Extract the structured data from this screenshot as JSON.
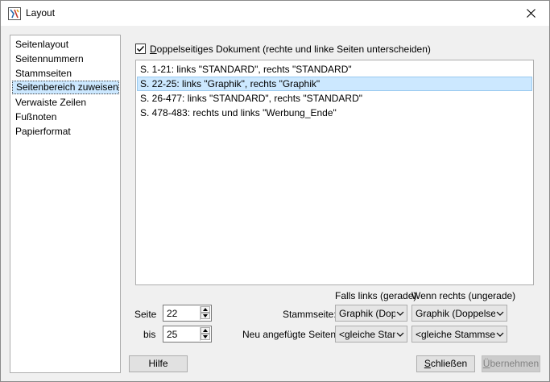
{
  "window": {
    "title": "Layout"
  },
  "nav": {
    "items": [
      {
        "label": "Seitenlayout"
      },
      {
        "label": "Seitennummern"
      },
      {
        "label": "Stammseiten"
      },
      {
        "label": "Seitenbereich zuweisen",
        "selected": true
      },
      {
        "label": "Verwaiste Zeilen"
      },
      {
        "label": "Fußnoten"
      },
      {
        "label": "Papierformat"
      }
    ]
  },
  "duplex": {
    "checked": true,
    "label_accel": "D",
    "label_rest": "oppelseitiges Dokument (rechte und linke Seiten unterscheiden)"
  },
  "ranges": [
    {
      "text": "S. 1-21: links \"STANDARD\", rechts \"STANDARD\""
    },
    {
      "text": "S. 22-25: links \"Graphik\", rechts \"Graphik\"",
      "selected": true
    },
    {
      "text": "S. 26-477: links \"STANDARD\", rechts \"STANDARD\""
    },
    {
      "text": "S. 478-483: rechts und links \"Werbung_Ende\""
    }
  ],
  "controls": {
    "seite_label": "Seite",
    "seite_value": "22",
    "bis_label": "bis",
    "bis_value": "25",
    "col_left_header": "Falls links (gerade)",
    "col_right_header": "Wenn rechts (ungerade)",
    "stammseite_label": "Stammseite:",
    "stammseite_left": "Graphik (Doppelseite)",
    "stammseite_right": "Graphik (Doppelseite)",
    "neu_label": "Neu angefügte Seiten:",
    "neu_left": "<gleiche Stammseite>",
    "neu_right": "<gleiche Stammseite>"
  },
  "buttons": {
    "help": "Hilfe",
    "close_accel": "S",
    "close_rest": "chließen",
    "apply_accel": "Ü",
    "apply_rest": "bernehmen"
  },
  "colors": {
    "selection": "#cce8ff",
    "button_face": "#e1e1e1",
    "dialog_bg": "#f0f0f0"
  }
}
